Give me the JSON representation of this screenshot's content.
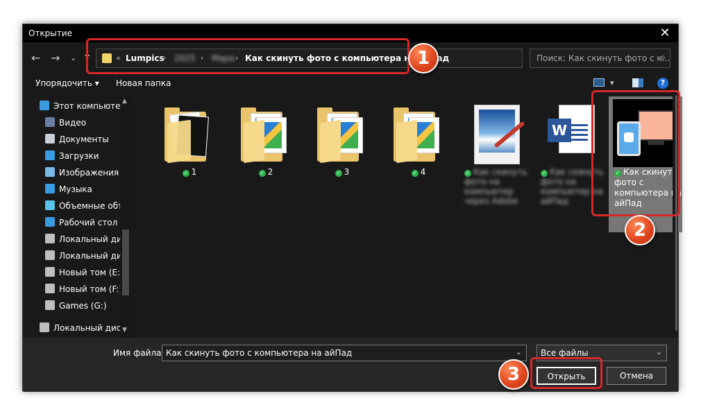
{
  "window": {
    "title": "Открытие",
    "close_glyph": "✕"
  },
  "nav": {
    "back": "←",
    "forward": "→",
    "recent": "⌄",
    "up": "↑"
  },
  "address": {
    "crumbs": [
      "Lumpics",
      "2025",
      "Мара",
      "Как скинуть фото с компьютера на айПад"
    ],
    "separator": "›",
    "prefix": "«",
    "dropdown": "⌄",
    "refresh": "↻"
  },
  "search": {
    "placeholder": "Поиск: Как скинуть фото с к...",
    "icon": "⌕"
  },
  "toolbar": {
    "organize": "Упорядочить ▾",
    "new_folder": "Новая папка",
    "view_dd": "▾",
    "help": "?"
  },
  "sidebar": {
    "items": [
      {
        "label": "Этот компьютер",
        "icon": "computer-icon",
        "color": "#3a9be0"
      },
      {
        "label": "Видео",
        "icon": "video-icon",
        "color": "#6c7fa6"
      },
      {
        "label": "Документы",
        "icon": "documents-icon",
        "color": "#c9cfd8"
      },
      {
        "label": "Загрузки",
        "icon": "downloads-icon",
        "color": "#3a9be0"
      },
      {
        "label": "Изображения",
        "icon": "pictures-icon",
        "color": "#7ab8e8"
      },
      {
        "label": "Музыка",
        "icon": "music-icon",
        "color": "#3a9be0"
      },
      {
        "label": "Объемные объ",
        "icon": "3d-objects-icon",
        "color": "#5bc1e8"
      },
      {
        "label": "Рабочий стол",
        "icon": "desktop-icon",
        "color": "#3a9be0"
      },
      {
        "label": "Локальный дис",
        "icon": "drive-icon",
        "color": "#bfbfbf"
      },
      {
        "label": "Локальный дис",
        "icon": "drive-icon",
        "color": "#bfbfbf"
      },
      {
        "label": "Новый том (E:)",
        "icon": "drive-icon",
        "color": "#bfbfbf"
      },
      {
        "label": "Новый том (F:)",
        "icon": "drive-icon",
        "color": "#bfbfbf"
      },
      {
        "label": "Games (G:)",
        "icon": "drive-icon",
        "color": "#bfbfbf"
      },
      {
        "label": "Локальный диск",
        "icon": "drive-icon",
        "color": "#bfbfbf"
      }
    ]
  },
  "files": [
    {
      "name": "1",
      "type": "folder-docs"
    },
    {
      "name": "2",
      "type": "folder-photos"
    },
    {
      "name": "3",
      "type": "folder-photos"
    },
    {
      "name": "4",
      "type": "folder-photos"
    },
    {
      "name": "Как скинуть фото на компьютер через Adobe",
      "type": "image-paint"
    },
    {
      "name": "Как скинуть фото на компьютер на айПад",
      "type": "word-doc"
    },
    {
      "name": "Как скинуть фото с компьютера на айПад",
      "type": "image-selected"
    }
  ],
  "bottom": {
    "filename_label": "Имя файла:",
    "filename_value": "Как скинуть фото с компьютера на айПад",
    "dropdown": "⌄",
    "filetype": "Все файлы",
    "open": "Открыть",
    "cancel": "Отмена"
  },
  "markers": [
    "1",
    "2",
    "3"
  ],
  "colors": {
    "highlight": "#d62828",
    "marker": "#e0471f",
    "check": "#2cb34a"
  }
}
